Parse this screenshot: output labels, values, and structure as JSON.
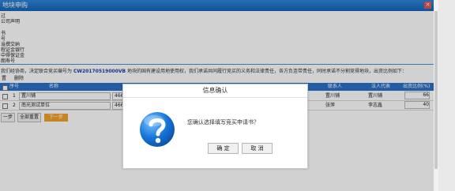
{
  "window": {
    "title": "地块申购"
  },
  "side_lines": [
    "过",
    "公司声明",
    "书",
    "号",
    "当撰交纳",
    "程证金银行",
    "中得保证金",
    "朗寿号"
  ],
  "notice": {
    "prefix": "我们经协商，决定联合竞买编号为",
    "code": "CW20170519000VB",
    "suffix": "地块的国有建设用地使用权，我们承诺共同履行竞买的义务和法律责任，各方负连带责任，同时承诺不分割竞得地块，出资比例如下："
  },
  "toolbar": {
    "add": "置",
    "delete": "删除"
  },
  "table": {
    "headers": [
      "序号",
      "名称",
      "联系人",
      "法人代表",
      "出资比例(%)"
    ],
    "rows": [
      {
        "index": "1",
        "name": "置川铺",
        "code": "4665",
        "contact": "置川铺",
        "legal_rep": "置川铺",
        "ratio": "66"
      },
      {
        "index": "2",
        "name": "南光测试单位",
        "code": "4665",
        "contact": "张萍",
        "legal_rep": "李志鑫",
        "ratio": "40"
      }
    ]
  },
  "buttons": {
    "prev": "一步",
    "reset": "全部重置",
    "next": "下一步"
  },
  "dialog": {
    "title": "信息确认",
    "message": "您确认选择填写竞买申请书？",
    "ok": "确 定",
    "cancel": "取 消"
  },
  "colors": {
    "titlebar": "#1f74c9",
    "header": "#2a72c8",
    "next_button": "#f1a32a",
    "icon": "#1676d8"
  }
}
